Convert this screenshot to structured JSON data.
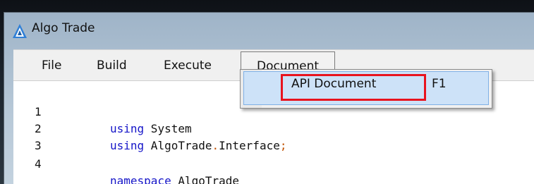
{
  "window": {
    "title": "Algo Trade",
    "icon": "algo-trade-triangle-icon"
  },
  "menubar": {
    "items": [
      {
        "label": "File"
      },
      {
        "label": "Build"
      },
      {
        "label": "Execute"
      },
      {
        "label": "Document",
        "open": true
      }
    ]
  },
  "dropdown": {
    "items": [
      {
        "label": "API Document",
        "shortcut": "F1",
        "highlighted": true
      }
    ]
  },
  "editor": {
    "lines": [
      {
        "number": "1",
        "code": "using System"
      },
      {
        "number": "2",
        "code": "using AlgoTrade.Interface;"
      },
      {
        "number": "3",
        "code": ""
      },
      {
        "number": "4",
        "code": "namespace AlgoTrade"
      }
    ]
  },
  "colors": {
    "keyword": "#1515c8",
    "highlight_box": "#e8131e",
    "menu_selection": "#cde2f8"
  }
}
